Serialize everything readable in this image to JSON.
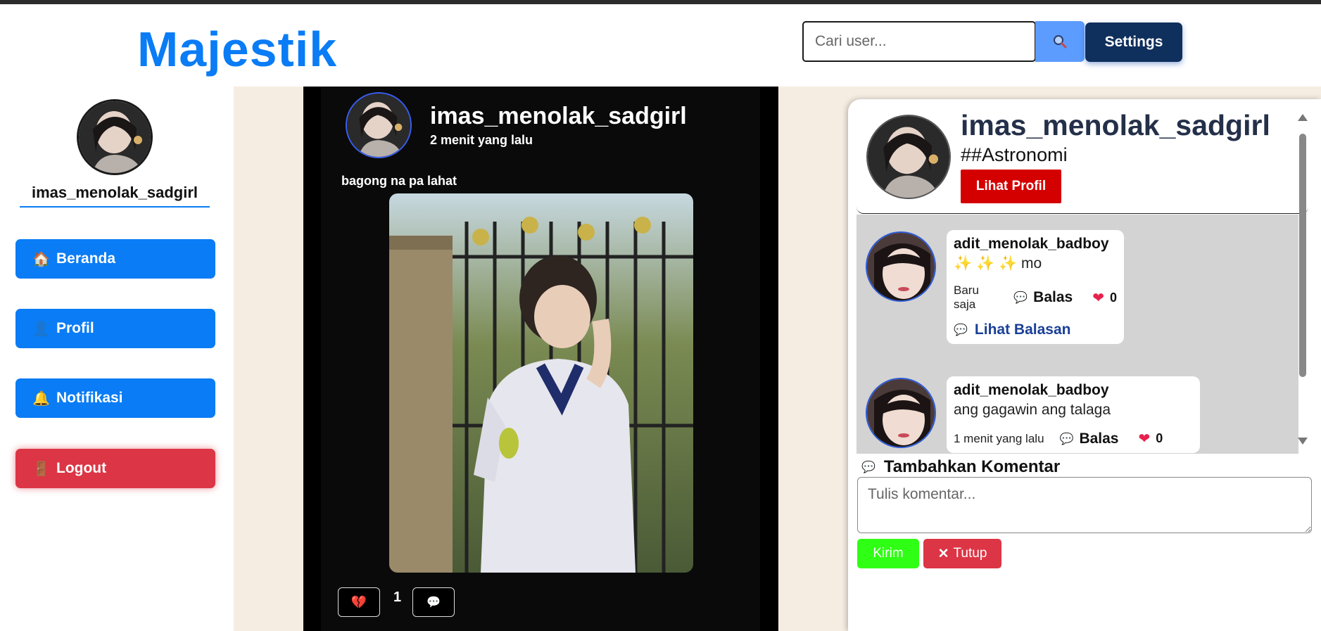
{
  "app": {
    "logo": "Majestik"
  },
  "search": {
    "placeholder": "Cari user..."
  },
  "header": {
    "settings_label": "Settings"
  },
  "sidebar": {
    "username": "imas_menolak_sadgirl",
    "items": [
      {
        "label": "Beranda",
        "icon": "house-icon"
      },
      {
        "label": "Profil",
        "icon": "user-icon"
      },
      {
        "label": "Notifikasi",
        "icon": "bell-icon"
      },
      {
        "label": "Logout",
        "icon": "door-icon"
      }
    ]
  },
  "post": {
    "username": "imas_menolak_sadgirl",
    "time": "2 menit yang lalu",
    "caption": "bagong na pa lahat",
    "like_count": "1"
  },
  "panel": {
    "username": "imas_menolak_sadgirl",
    "tag": "##Astronomi",
    "profile_button": "Lihat Profil",
    "comments": [
      {
        "user": "adit_menolak_badboy",
        "text": "✨ ✨ ✨  mo",
        "time": "Baru saja",
        "reply": "Balas",
        "likes": "0",
        "view_replies": "Lihat Balasan"
      },
      {
        "user": "adit_menolak_badboy",
        "text": "ang gagawin ang talaga",
        "time": "1 menit yang lalu",
        "reply": "Balas",
        "likes": "0"
      }
    ],
    "add_comment_title": "Tambahkan Komentar",
    "comment_placeholder": "Tulis komentar...",
    "send_label": "Kirim",
    "close_label": "Tutup"
  },
  "colors": {
    "brand": "#0a7cf5",
    "logout": "#dc3545",
    "send": "#2fff14",
    "profile": "#d40000"
  }
}
